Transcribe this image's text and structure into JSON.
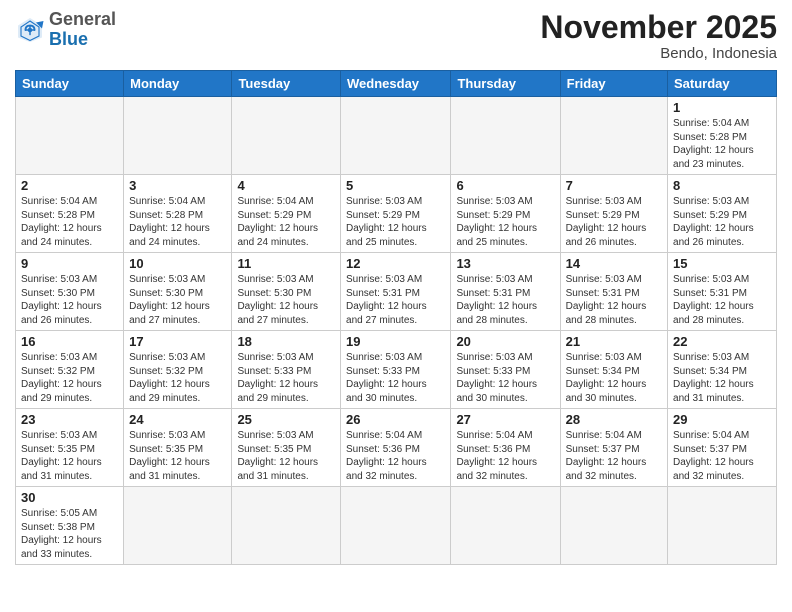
{
  "header": {
    "logo_general": "General",
    "logo_blue": "Blue",
    "month_year": "November 2025",
    "location": "Bendo, Indonesia"
  },
  "weekdays": [
    "Sunday",
    "Monday",
    "Tuesday",
    "Wednesday",
    "Thursday",
    "Friday",
    "Saturday"
  ],
  "weeks": [
    [
      {
        "day": "",
        "info": "",
        "empty": true
      },
      {
        "day": "",
        "info": "",
        "empty": true
      },
      {
        "day": "",
        "info": "",
        "empty": true
      },
      {
        "day": "",
        "info": "",
        "empty": true
      },
      {
        "day": "",
        "info": "",
        "empty": true
      },
      {
        "day": "",
        "info": "",
        "empty": true
      },
      {
        "day": "1",
        "info": "Sunrise: 5:04 AM\nSunset: 5:28 PM\nDaylight: 12 hours\nand 23 minutes."
      }
    ],
    [
      {
        "day": "2",
        "info": "Sunrise: 5:04 AM\nSunset: 5:28 PM\nDaylight: 12 hours\nand 24 minutes."
      },
      {
        "day": "3",
        "info": "Sunrise: 5:04 AM\nSunset: 5:28 PM\nDaylight: 12 hours\nand 24 minutes."
      },
      {
        "day": "4",
        "info": "Sunrise: 5:04 AM\nSunset: 5:29 PM\nDaylight: 12 hours\nand 24 minutes."
      },
      {
        "day": "5",
        "info": "Sunrise: 5:03 AM\nSunset: 5:29 PM\nDaylight: 12 hours\nand 25 minutes."
      },
      {
        "day": "6",
        "info": "Sunrise: 5:03 AM\nSunset: 5:29 PM\nDaylight: 12 hours\nand 25 minutes."
      },
      {
        "day": "7",
        "info": "Sunrise: 5:03 AM\nSunset: 5:29 PM\nDaylight: 12 hours\nand 26 minutes."
      },
      {
        "day": "8",
        "info": "Sunrise: 5:03 AM\nSunset: 5:29 PM\nDaylight: 12 hours\nand 26 minutes."
      }
    ],
    [
      {
        "day": "9",
        "info": "Sunrise: 5:03 AM\nSunset: 5:30 PM\nDaylight: 12 hours\nand 26 minutes."
      },
      {
        "day": "10",
        "info": "Sunrise: 5:03 AM\nSunset: 5:30 PM\nDaylight: 12 hours\nand 27 minutes."
      },
      {
        "day": "11",
        "info": "Sunrise: 5:03 AM\nSunset: 5:30 PM\nDaylight: 12 hours\nand 27 minutes."
      },
      {
        "day": "12",
        "info": "Sunrise: 5:03 AM\nSunset: 5:31 PM\nDaylight: 12 hours\nand 27 minutes."
      },
      {
        "day": "13",
        "info": "Sunrise: 5:03 AM\nSunset: 5:31 PM\nDaylight: 12 hours\nand 28 minutes."
      },
      {
        "day": "14",
        "info": "Sunrise: 5:03 AM\nSunset: 5:31 PM\nDaylight: 12 hours\nand 28 minutes."
      },
      {
        "day": "15",
        "info": "Sunrise: 5:03 AM\nSunset: 5:31 PM\nDaylight: 12 hours\nand 28 minutes."
      }
    ],
    [
      {
        "day": "16",
        "info": "Sunrise: 5:03 AM\nSunset: 5:32 PM\nDaylight: 12 hours\nand 29 minutes."
      },
      {
        "day": "17",
        "info": "Sunrise: 5:03 AM\nSunset: 5:32 PM\nDaylight: 12 hours\nand 29 minutes."
      },
      {
        "day": "18",
        "info": "Sunrise: 5:03 AM\nSunset: 5:33 PM\nDaylight: 12 hours\nand 29 minutes."
      },
      {
        "day": "19",
        "info": "Sunrise: 5:03 AM\nSunset: 5:33 PM\nDaylight: 12 hours\nand 30 minutes."
      },
      {
        "day": "20",
        "info": "Sunrise: 5:03 AM\nSunset: 5:33 PM\nDaylight: 12 hours\nand 30 minutes."
      },
      {
        "day": "21",
        "info": "Sunrise: 5:03 AM\nSunset: 5:34 PM\nDaylight: 12 hours\nand 30 minutes."
      },
      {
        "day": "22",
        "info": "Sunrise: 5:03 AM\nSunset: 5:34 PM\nDaylight: 12 hours\nand 31 minutes."
      }
    ],
    [
      {
        "day": "23",
        "info": "Sunrise: 5:03 AM\nSunset: 5:35 PM\nDaylight: 12 hours\nand 31 minutes."
      },
      {
        "day": "24",
        "info": "Sunrise: 5:03 AM\nSunset: 5:35 PM\nDaylight: 12 hours\nand 31 minutes."
      },
      {
        "day": "25",
        "info": "Sunrise: 5:03 AM\nSunset: 5:35 PM\nDaylight: 12 hours\nand 31 minutes."
      },
      {
        "day": "26",
        "info": "Sunrise: 5:04 AM\nSunset: 5:36 PM\nDaylight: 12 hours\nand 32 minutes."
      },
      {
        "day": "27",
        "info": "Sunrise: 5:04 AM\nSunset: 5:36 PM\nDaylight: 12 hours\nand 32 minutes."
      },
      {
        "day": "28",
        "info": "Sunrise: 5:04 AM\nSunset: 5:37 PM\nDaylight: 12 hours\nand 32 minutes."
      },
      {
        "day": "29",
        "info": "Sunrise: 5:04 AM\nSunset: 5:37 PM\nDaylight: 12 hours\nand 32 minutes."
      }
    ],
    [
      {
        "day": "30",
        "info": "Sunrise: 5:05 AM\nSunset: 5:38 PM\nDaylight: 12 hours\nand 33 minutes."
      },
      {
        "day": "",
        "info": "",
        "empty": true
      },
      {
        "day": "",
        "info": "",
        "empty": true
      },
      {
        "day": "",
        "info": "",
        "empty": true
      },
      {
        "day": "",
        "info": "",
        "empty": true
      },
      {
        "day": "",
        "info": "",
        "empty": true
      },
      {
        "day": "",
        "info": "",
        "empty": true
      }
    ]
  ]
}
